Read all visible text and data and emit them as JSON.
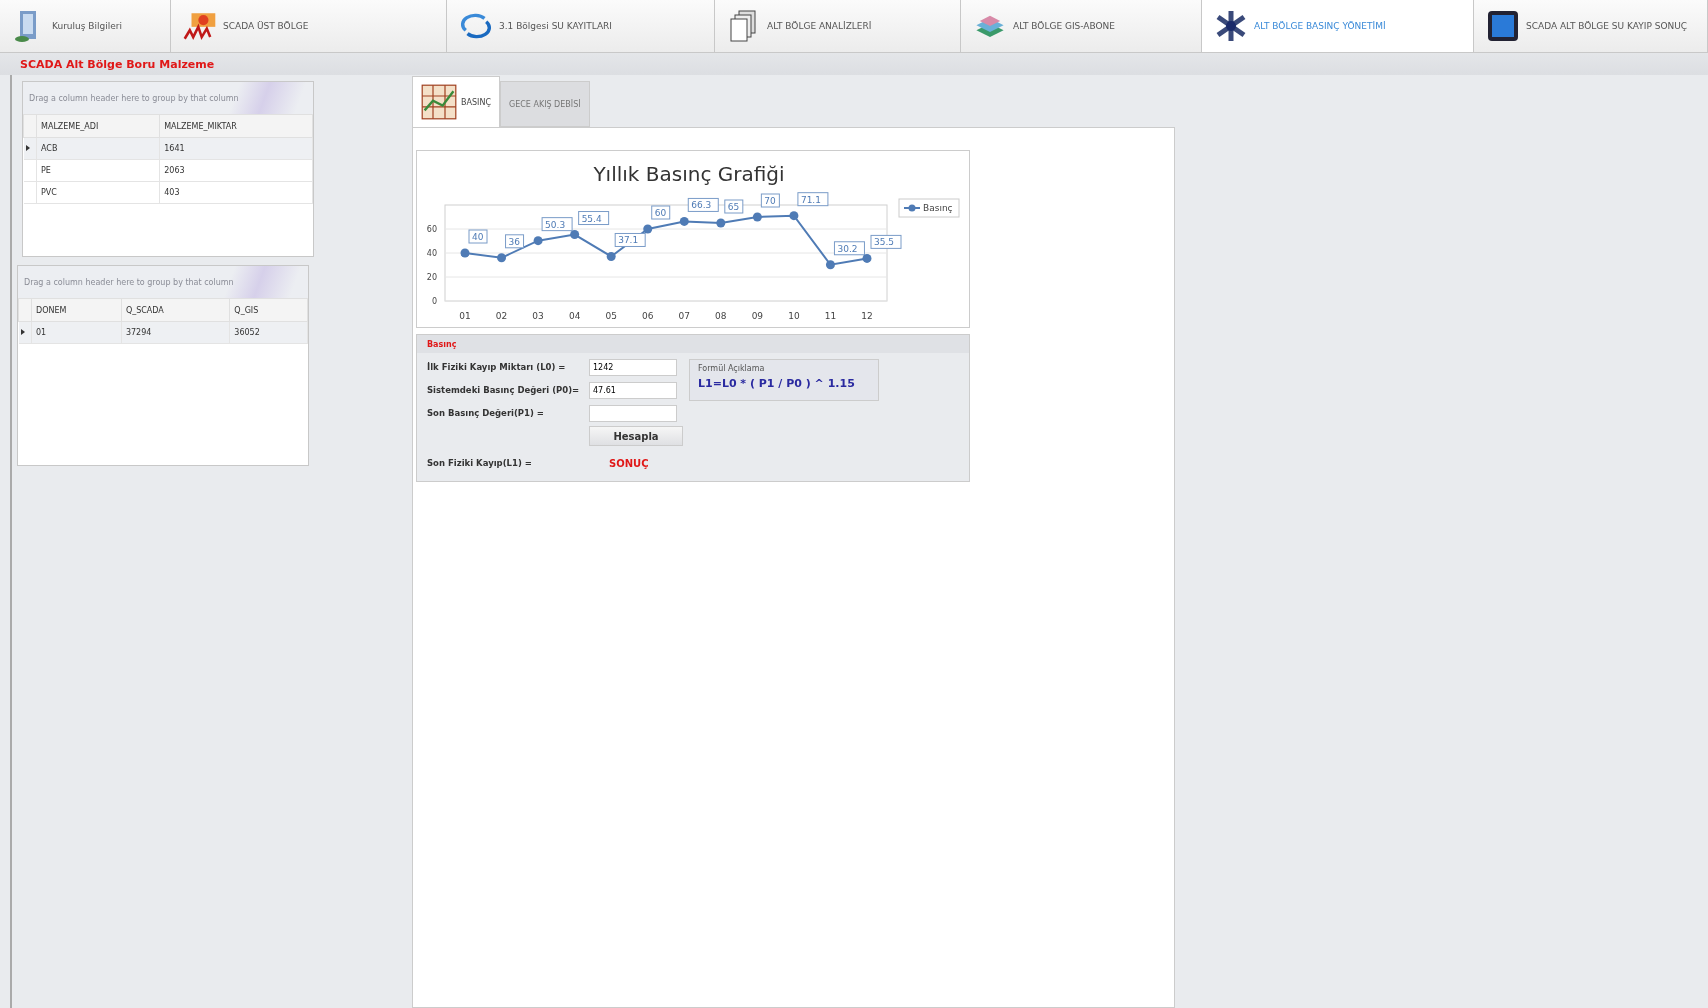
{
  "tabs": [
    {
      "label": "Kuruluş Bilgileri",
      "selected": false
    },
    {
      "label": "SCADA ÜST BÖLGE",
      "selected": false
    },
    {
      "label": "3.1 Bölgesi SU KAYITLARI",
      "selected": false
    },
    {
      "label": "ALT BÖLGE ANALİZLERİ",
      "selected": false
    },
    {
      "label": "ALT BÖLGE GIS-ABONE",
      "selected": false
    },
    {
      "label": "ALT BÖLGE BASINÇ YÖNETİMİ",
      "selected": true
    },
    {
      "label": "SCADA ALT BÖLGE SU KAYIP SONUÇ",
      "selected": false
    }
  ],
  "page_title": "SCADA Alt Bölge Boru Malzeme",
  "grids": [
    {
      "group_hint": "Drag a column header here to group by that column",
      "columns": [
        "MALZEME_ADI",
        "MALZEME_MIKTAR"
      ],
      "rows": [
        {
          "cells": [
            "ACB",
            "1641"
          ],
          "selected": true
        },
        {
          "cells": [
            "PE",
            "2063"
          ],
          "selected": false
        },
        {
          "cells": [
            "PVC",
            "403"
          ],
          "selected": false
        }
      ]
    },
    {
      "group_hint": "Drag a column header here to group by that column",
      "columns": [
        "DONEM",
        "Q_SCADA",
        "Q_GIS"
      ],
      "rows": [
        {
          "cells": [
            "01",
            "37294",
            "36052"
          ],
          "selected": true
        }
      ]
    }
  ],
  "inner_tabs": [
    {
      "label": "BASINÇ",
      "selected": true
    },
    {
      "label": "GECE AKIŞ DEBİSİ",
      "selected": false
    }
  ],
  "chart": {
    "chart_data": {
      "type": "line",
      "title": "Yıllık Basınç Grafiği",
      "categories": [
        "01",
        "02",
        "03",
        "04",
        "05",
        "06",
        "07",
        "08",
        "09",
        "10",
        "11",
        "12"
      ],
      "series": [
        {
          "name": "Basınç",
          "color": "#4f7bb5",
          "values": [
            40,
            36,
            50.3,
            55.4,
            37.1,
            60,
            66.3,
            65,
            70,
            71.1,
            30.2,
            35.5
          ]
        }
      ],
      "ylim": [
        0,
        80
      ],
      "yticks": [
        0,
        20,
        40,
        60
      ],
      "data_labels": true,
      "grid": true,
      "marker": "circle"
    }
  },
  "form": {
    "title": "Basınç",
    "fields": [
      {
        "label": "İlk Fiziki Kayıp Miktarı (L0) =",
        "value": "1242"
      },
      {
        "label": "Sistemdeki Basınç Değeri (P0)=",
        "value": "47.61"
      },
      {
        "label": "Son Basınç Değeri(P1) ="
      }
    ],
    "formula_title": "Formül Açıklama",
    "formula": "L1=L0 * ( P1 / P0 ) ^ 1.15",
    "button": "Hesapla",
    "result_label": "Son Fiziki Kayıp(L1) =",
    "result": "SONUÇ"
  }
}
